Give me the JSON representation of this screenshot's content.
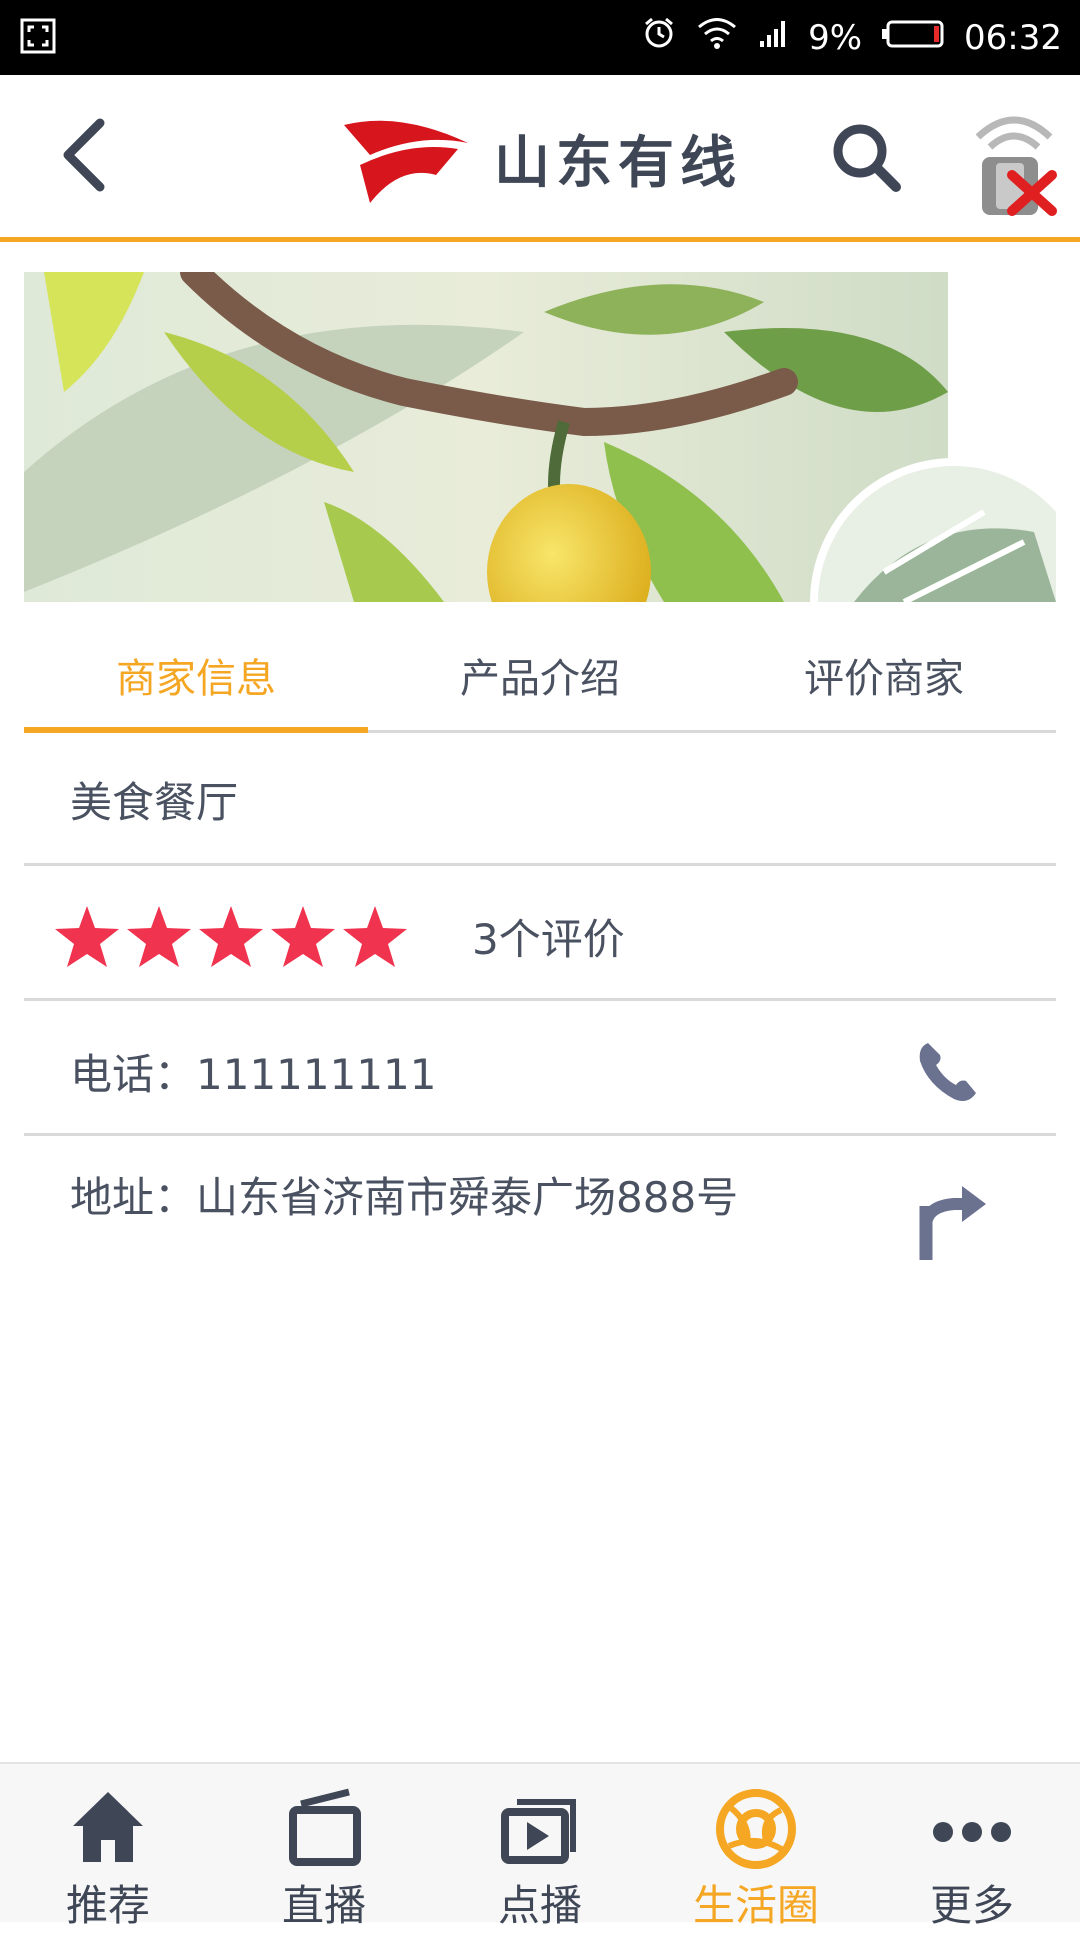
{
  "status_bar": {
    "battery": "9%",
    "time": "06:32"
  },
  "header": {
    "logo_text": "山东有线",
    "back_icon": "chevron-left-icon",
    "search_icon": "search-icon",
    "remote_icon": "remote-disconnected-icon"
  },
  "tabs": [
    {
      "label": "商家信息",
      "active": true
    },
    {
      "label": "产品介绍",
      "active": false
    },
    {
      "label": "评价商家",
      "active": false
    }
  ],
  "merchant": {
    "category": "美食餐厅",
    "rating_stars": 5,
    "review_count": "3个评价",
    "phone": "电话：111111111",
    "address": "地址：山东省济南市舜泰广场888号"
  },
  "bottom_nav": [
    {
      "label": "推荐",
      "icon": "home-icon",
      "active": false
    },
    {
      "label": "直播",
      "icon": "tv-icon",
      "active": false
    },
    {
      "label": "点播",
      "icon": "play-icon",
      "active": false
    },
    {
      "label": "生活圈",
      "icon": "life-circle-icon",
      "active": true
    },
    {
      "label": "更多",
      "icon": "more-icon",
      "active": false
    }
  ],
  "colors": {
    "accent": "#f5a623",
    "star": "#f0344f",
    "text": "#4a5160",
    "icon_gray": "#6b7290"
  }
}
